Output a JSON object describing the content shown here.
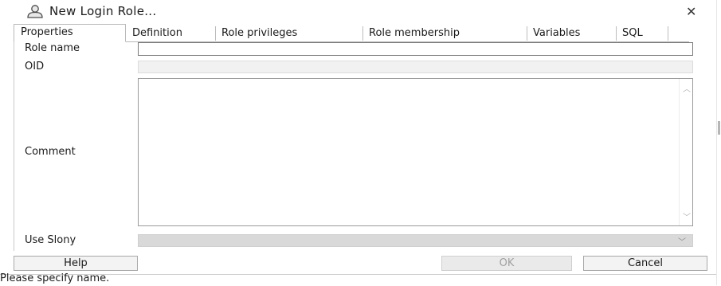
{
  "window": {
    "title": "New Login Role...",
    "close_glyph": "✕",
    "icon": "user-icon"
  },
  "tabs": [
    {
      "label": "Properties",
      "active": true
    },
    {
      "label": "Definition"
    },
    {
      "label": "Role privileges"
    },
    {
      "label": "Role membership"
    },
    {
      "label": "Variables"
    },
    {
      "label": "SQL"
    }
  ],
  "form": {
    "role_name": {
      "label": "Role name",
      "value": ""
    },
    "oid": {
      "label": "OID",
      "value": ""
    },
    "comment": {
      "label": "Comment",
      "value": ""
    },
    "use_slony": {
      "label": "Use Slony",
      "value": ""
    }
  },
  "buttons": {
    "help": "Help",
    "ok": "OK",
    "cancel": "Cancel"
  },
  "status": {
    "message": "Please specify name."
  },
  "colors": {
    "disabled_field": "#d9d9d9",
    "border": "#7a7a7a",
    "background": "#ffffff"
  }
}
